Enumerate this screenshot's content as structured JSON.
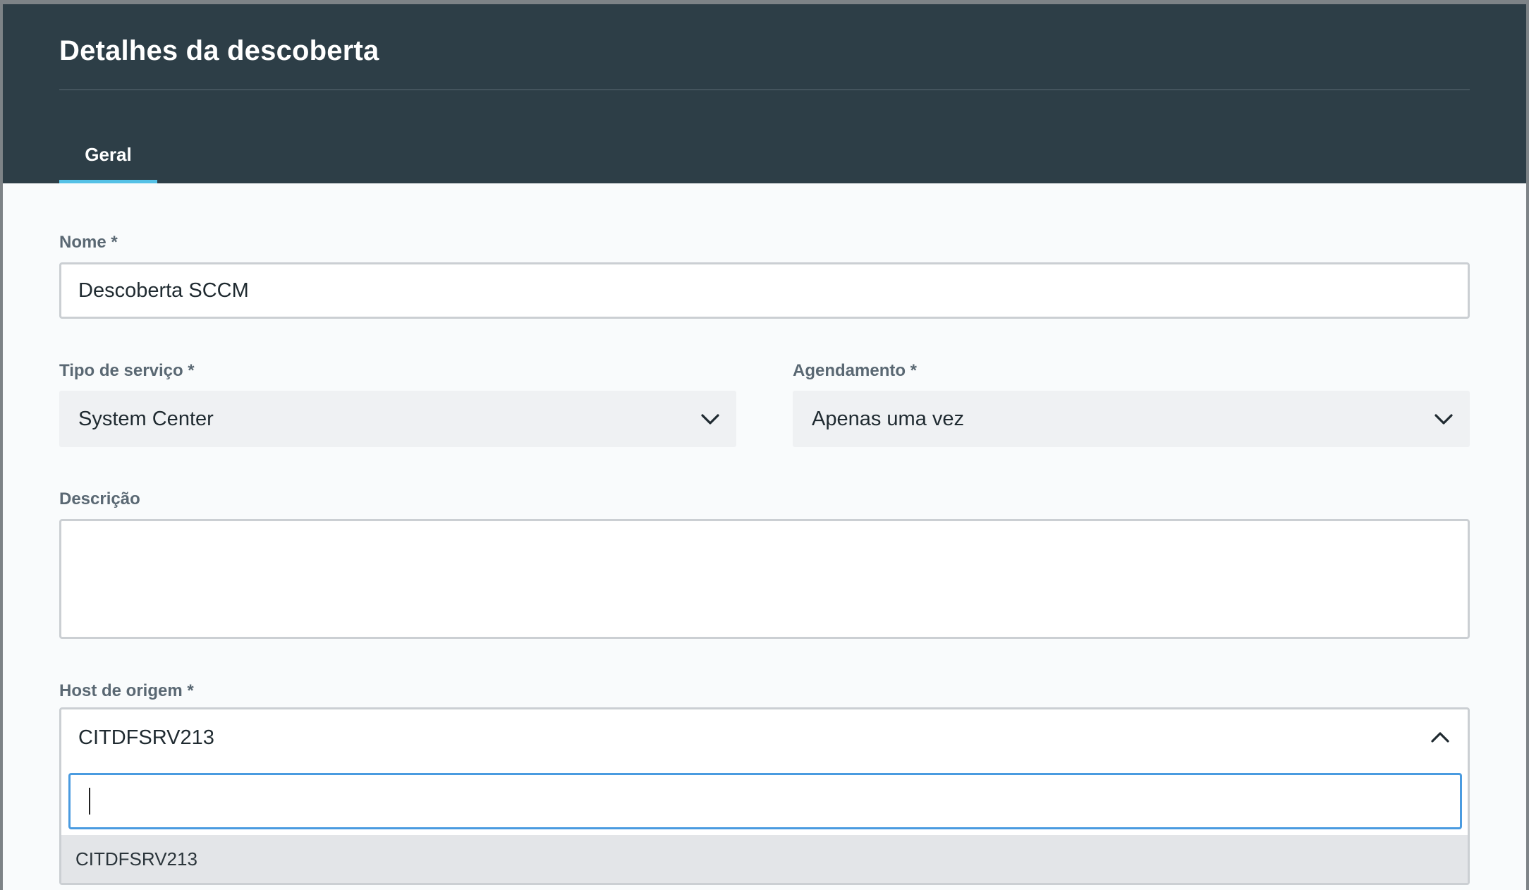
{
  "modal": {
    "title": "Detalhes da descoberta",
    "tabs": [
      {
        "label": "Geral",
        "active": true
      }
    ]
  },
  "form": {
    "name": {
      "label": "Nome *",
      "value": "Descoberta SCCM"
    },
    "service_type": {
      "label": "Tipo de serviço *",
      "value": "System Center"
    },
    "schedule": {
      "label": "Agendamento *",
      "value": "Apenas uma vez"
    },
    "description": {
      "label": "Descrição",
      "value": ""
    },
    "source_host": {
      "label": "Host de origem *",
      "value": "CITDFSRV213",
      "search_value": "",
      "options": [
        "CITDFSRV213"
      ],
      "expanded": true
    }
  },
  "colors": {
    "header_bg": "#2d3e47",
    "tab_accent": "#55c1e6",
    "focus_border": "#4a9be0"
  },
  "icons": {
    "service_type_chevron": "chevron-down-icon",
    "schedule_chevron": "chevron-down-icon",
    "host_chevron": "chevron-up-icon"
  }
}
